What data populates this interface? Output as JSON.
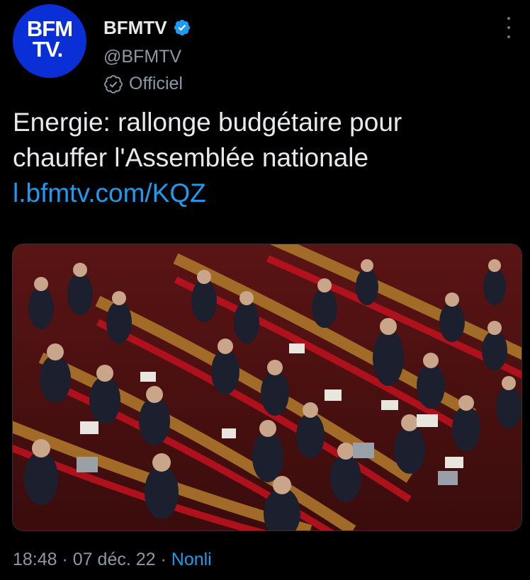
{
  "author": {
    "logo_line1": "BFM",
    "logo_line2": "TV.",
    "display_name": "BFMTV",
    "handle": "@BFMTV",
    "official_label": "Officiel",
    "verified_icon": "verified-badge-icon",
    "official_icon": "official-check-badge-icon"
  },
  "tweet": {
    "text_line1": "Energie: rallonge budgétaire pour",
    "text_line2": "chauffer l'Assemblée nationale",
    "link": "l.bfmtv.com/KQZ"
  },
  "footer": {
    "time": "18:48",
    "separator1": " · ",
    "date": "07 déc. 22",
    "separator2": " · ",
    "source": "Nonli"
  },
  "colors": {
    "background": "#000000",
    "text": "#e7e9ea",
    "secondary": "#8b98a5",
    "link": "#1d9bf0",
    "brand": "#0a2fd6"
  }
}
